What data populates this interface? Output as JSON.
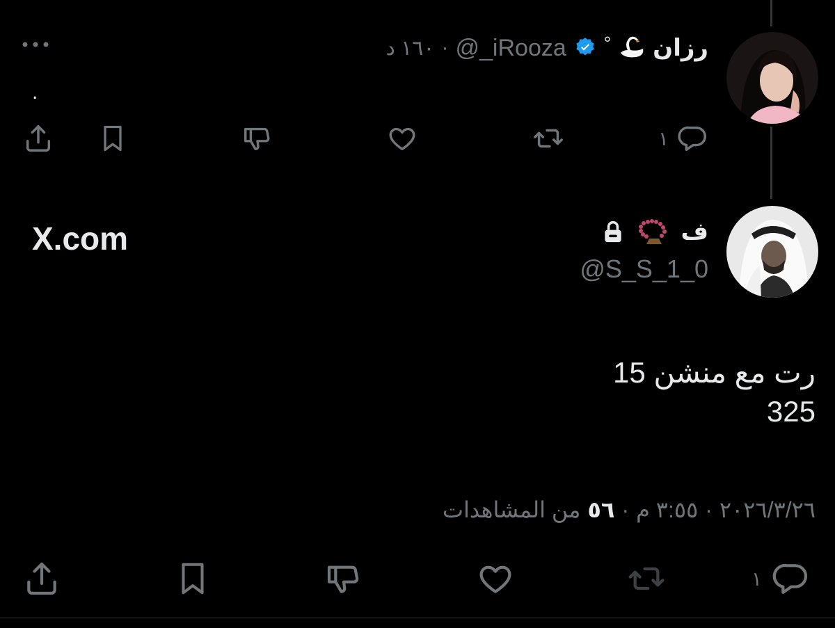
{
  "tweet_top": {
    "author_name": "رزان",
    "name_decor": "°",
    "handle": "@_iRooza",
    "time": "١٦٠ د",
    "separator": "·",
    "body_text": ".",
    "reply_count": "١",
    "icons": [
      "more-icon",
      "reply-icon",
      "retweet-icon",
      "like-icon",
      "dislike-icon",
      "bookmark-icon",
      "share-icon"
    ]
  },
  "tweet_main": {
    "author_name": "ف",
    "handle": "@S_S_1_0",
    "brand_badge": "X.com",
    "body_lines": [
      "15 رت مع منشن",
      "325"
    ],
    "date": "٢٠٢٦/٣/٢٦",
    "time": "٣:٥٥ م",
    "views_count": "٥٦",
    "views_label": "من المشاهدات",
    "separator": "·",
    "reply_count": "١",
    "icons": [
      "lock-icon",
      "reply-icon",
      "retweet-icon",
      "like-icon",
      "dislike-icon",
      "bookmark-icon",
      "share-icon"
    ]
  },
  "colors": {
    "background": "#000000",
    "text": "#e7e9ea",
    "muted": "#71767b",
    "verified": "#1d9bf0",
    "line": "#333639"
  }
}
